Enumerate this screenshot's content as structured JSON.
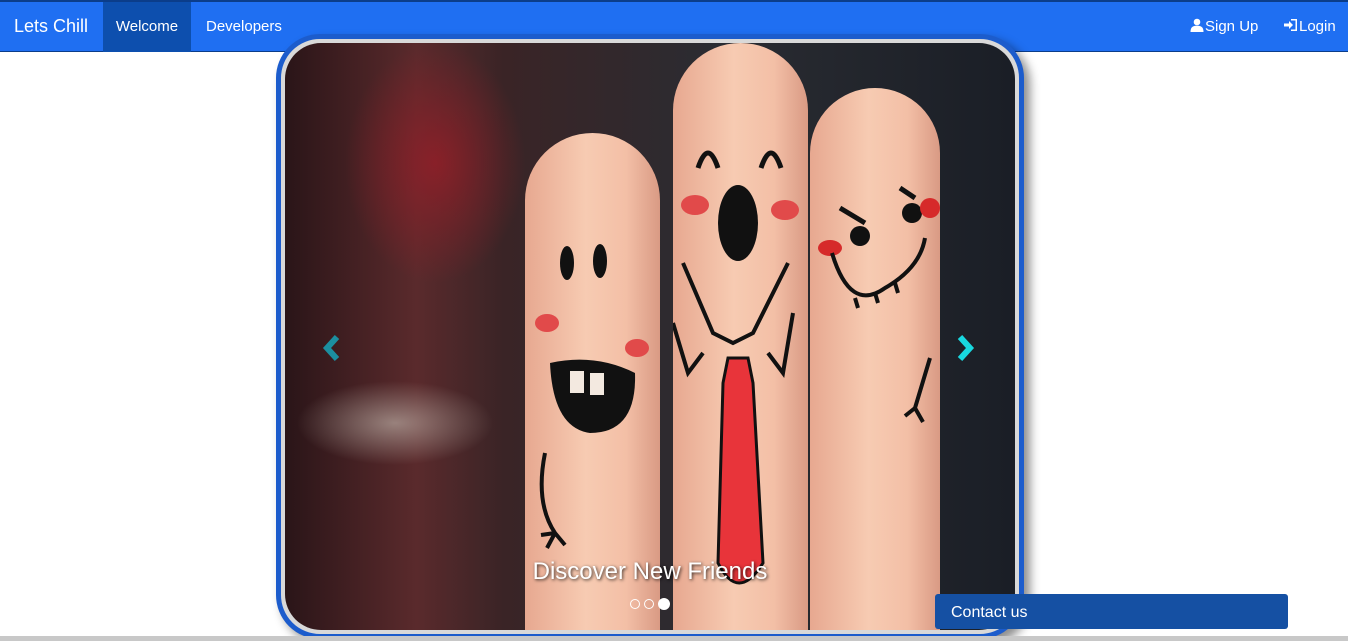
{
  "navbar": {
    "brand": "Lets Chill",
    "items": [
      {
        "label": "Welcome",
        "active": true
      },
      {
        "label": "Developers",
        "active": false
      }
    ],
    "signup_label": "Sign Up",
    "login_label": "Login",
    "signup_icon": "user-icon",
    "login_icon": "login-icon",
    "color": "#1f6ff2",
    "active_color": "#0d4fae"
  },
  "carousel": {
    "caption": "Discover New Friends",
    "slide_count": 3,
    "active_slide": 3,
    "prev_icon": "chevron-left-icon",
    "next_icon": "chevron-right-icon",
    "frame_color": "#1c5ccc"
  },
  "contact": {
    "label": "Contact us",
    "color": "#1550a3"
  }
}
